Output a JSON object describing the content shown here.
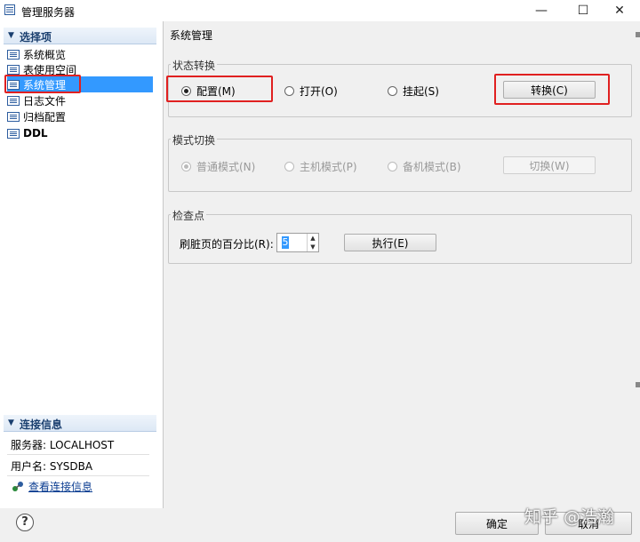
{
  "window": {
    "title": "管理服务器",
    "controls": {
      "minimize": "—",
      "maximize": "☐",
      "close": "✕"
    }
  },
  "sidebar": {
    "options_header": "选择项",
    "items": [
      {
        "label": "系统概览",
        "selected": false
      },
      {
        "label": "表使用空间",
        "selected": false
      },
      {
        "label": "系统管理",
        "selected": true
      },
      {
        "label": "日志文件",
        "selected": false
      },
      {
        "label": "归档配置",
        "selected": false
      },
      {
        "label": "DDL",
        "selected": false
      }
    ],
    "connection_header": "连接信息",
    "server_label": "服务器: LOCALHOST",
    "user_label": "用户名: SYSDBA",
    "view_link": "查看连接信息"
  },
  "main": {
    "title": "系统管理",
    "state_group": {
      "label": "状态转换",
      "options": [
        "配置(M)",
        "打开(O)",
        "挂起(S)"
      ],
      "selected_index": 0,
      "button": "转换(C)"
    },
    "mode_group": {
      "label": "模式切换",
      "options": [
        "普通模式(N)",
        "主机模式(P)",
        "备机模式(B)"
      ],
      "selected_index": 0,
      "button": "切换(W)",
      "disabled": true
    },
    "checkpoint_group": {
      "label": "检查点",
      "field_label": "刷脏页的百分比(R):",
      "value": "5",
      "button": "执行(E)"
    }
  },
  "footer": {
    "help": "?",
    "ok": "确定",
    "cancel": "取消"
  },
  "watermark": "知乎 @浩瀚",
  "colors": {
    "selection": "#3399ff",
    "highlight_box": "#e02020",
    "header_text": "#1a3f6f"
  }
}
